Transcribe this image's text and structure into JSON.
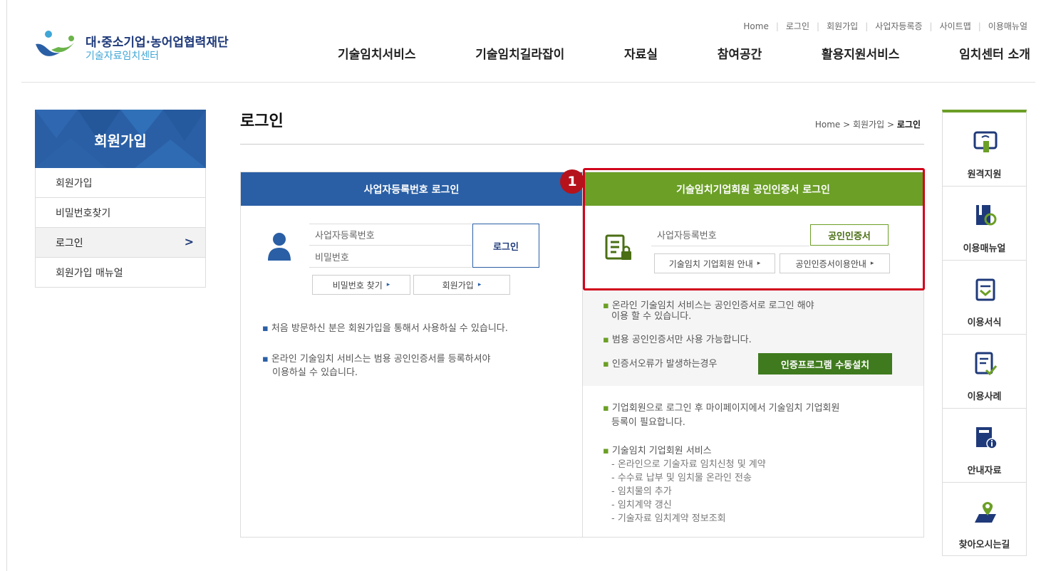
{
  "header": {
    "org_name": "대·중소기업·농어업협력재단",
    "center_name": "기술자료임치센터",
    "util_links": [
      "Home",
      "로그인",
      "회원가입",
      "사업자등록증",
      "사이트맵",
      "이용매뉴얼"
    ],
    "nav": [
      "기술임치서비스",
      "기술임치길라잡이",
      "자료실",
      "참여공간",
      "활용지원서비스",
      "임치센터 소개"
    ]
  },
  "sidebar": {
    "title": "회원가입",
    "items": [
      {
        "label": "회원가입"
      },
      {
        "label": "비밀번호찾기"
      },
      {
        "label": "로그인",
        "active": true
      },
      {
        "label": "회원가입 매뉴얼"
      }
    ]
  },
  "page": {
    "title": "로그인",
    "breadcrumb": {
      "home": "Home",
      "sep": ">",
      "level1": "회원가입",
      "current": "로그인"
    }
  },
  "left_panel": {
    "header": "사업자등록번호 로그인",
    "biz_placeholder": "사업자등록번호",
    "pw_placeholder": "비밀번호",
    "login_button": "로그인",
    "find_pw_button": "비밀번호 찾기",
    "join_button": "회원가입",
    "notes": [
      "처음 방문하신 분은 회원가입을 통해서 사용하실 수 있습니다.",
      "온라인 기술임치 서비스는 범용 공인인증서를 등록하셔야",
      "이용하실 수 있습니다."
    ]
  },
  "right_panel": {
    "header": "기술임치기업회원 공인인증서 로그인",
    "biz_placeholder": "사업자등록번호",
    "cert_button": "공인인증서",
    "member_guide_button": "기술임치 기업회원 안내",
    "cert_guide_button": "공인인증서이용안내",
    "gray_notes": [
      "온라인 기술임치 서비스는 공인인증서로 로그인 해야",
      "이용 할 수 있습니다.",
      "범용 공인인증서만 사용 가능합니다.",
      "인증서오류가 발생하는경우"
    ],
    "install_button": "인증프로그램 수동설치",
    "notes": [
      "기업회원으로 로그인 후 마이페이지에서 기술임치 기업회원",
      "등록이 필요합니다.",
      "기술임치 기업회원 서비스"
    ],
    "service_list": [
      "- 온라인으로 기술자료 임치신청 및 계약",
      "- 수수료 납부 및 임치물 온라인 전송",
      "- 임치물의 추가",
      "- 임치계약 갱신",
      "- 기술자료 임치계약 정보조회"
    ]
  },
  "annotation": {
    "badge": "1"
  },
  "quick_menu": [
    {
      "label": "원격지원",
      "icon": "remote-support-icon"
    },
    {
      "label": "이용매뉴얼",
      "icon": "manual-icon"
    },
    {
      "label": "이용서식",
      "icon": "form-icon"
    },
    {
      "label": "이용사례",
      "icon": "case-icon"
    },
    {
      "label": "안내자료",
      "icon": "info-material-icon"
    },
    {
      "label": "찾아오시는길",
      "icon": "location-icon"
    }
  ],
  "colors": {
    "blue": "#2a5fa5",
    "green": "#6b9f26",
    "dark_green": "#3f7a1e",
    "red": "#d0021b"
  }
}
